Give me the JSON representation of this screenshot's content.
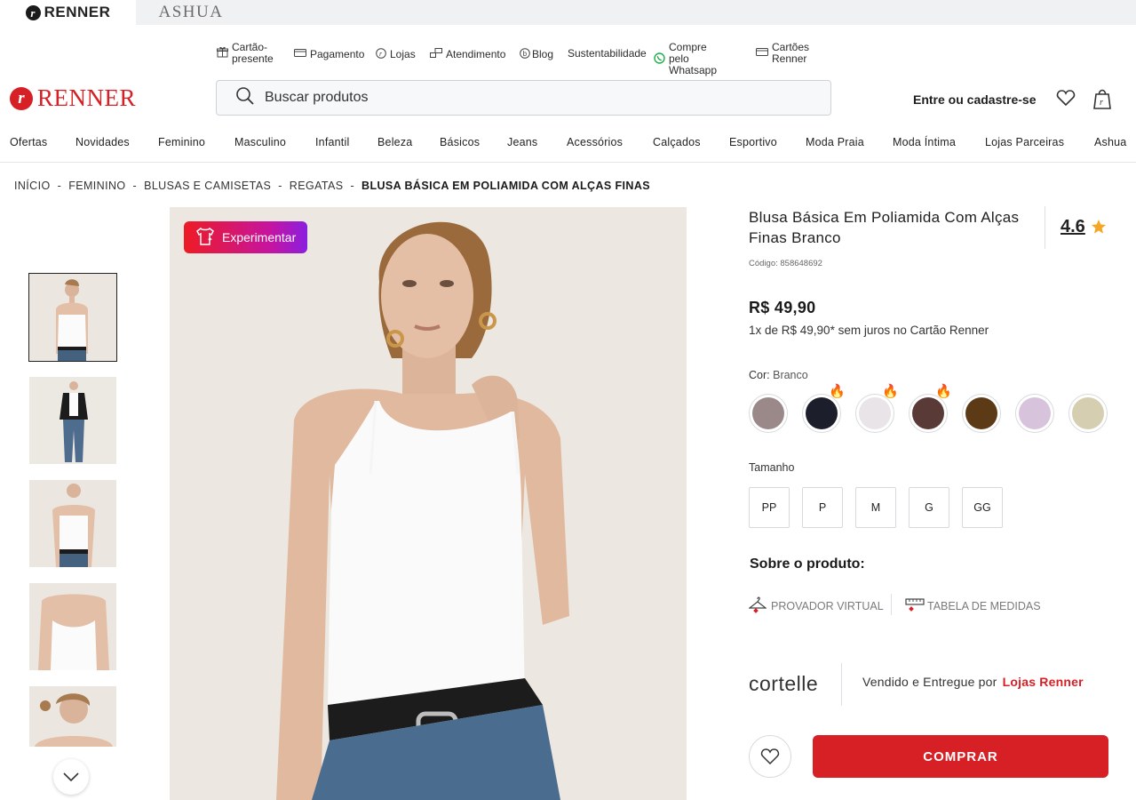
{
  "brands": {
    "renner": "RENNER",
    "ashua": "ASHUA"
  },
  "utility": [
    {
      "label": "Cartão-\npresente",
      "icon": "gift-icon"
    },
    {
      "label": "Pagamento",
      "icon": "payment-icon"
    },
    {
      "label": "Lojas",
      "icon": "store-icon"
    },
    {
      "label": "Atendimento",
      "icon": "support-icon"
    },
    {
      "label": "Blog",
      "icon": "blog-icon"
    },
    {
      "label": "Sustentabilidade",
      "icon": ""
    },
    {
      "label": "Compre pelo\nWhatsapp",
      "icon": "whatsapp-icon"
    },
    {
      "label": "Cartões\nRenner",
      "icon": "card-icon"
    }
  ],
  "header": {
    "logo": "RENNER",
    "search_placeholder": "Buscar produtos",
    "login": "Entre ou cadastre-se"
  },
  "nav": [
    "Ofertas",
    "Novidades",
    "Feminino",
    "Masculino",
    "Infantil",
    "Beleza",
    "Básicos",
    "Jeans",
    "Acessórios",
    "Calçados",
    "Esportivo",
    "Moda Praia",
    "Moda Íntima",
    "Lojas Parceiras",
    "Ashua"
  ],
  "breadcrumb": [
    "INÍCIO",
    "FEMININO",
    "BLUSAS E CAMISETAS",
    "REGATAS",
    "BLUSA BÁSICA EM POLIAMIDA COM ALÇAS FINAS"
  ],
  "try_on": "Experimentar",
  "product": {
    "title": "Blusa Básica Em Poliamida Com Alças Finas Branco",
    "rating": "4.6",
    "code": "Código: 858648692",
    "price": "R$ 49,90",
    "installments": "1x de R$ 49,90* sem juros no Cartão Renner",
    "color_label": "Cor:",
    "color_value": "Branco",
    "colors": [
      {
        "hex": "#9b8888",
        "hot": false
      },
      {
        "hex": "#1c1f2b",
        "hot": true
      },
      {
        "hex": "#e8e4e8",
        "hot": true
      },
      {
        "hex": "#5a3a36",
        "hot": true
      },
      {
        "hex": "#5c3a15",
        "hot": false
      },
      {
        "hex": "#d8c3dc",
        "hot": false
      },
      {
        "hex": "#d6ceb0",
        "hot": false
      }
    ],
    "size_label": "Tamanho",
    "sizes": [
      "PP",
      "P",
      "M",
      "G",
      "GG"
    ],
    "about": "Sobre o produto:",
    "virtual_fitting": "PROVADOR VIRTUAL",
    "size_chart": "TABELA DE MEDIDAS",
    "brand": "cortelle",
    "sold_by": "Vendido e Entregue por",
    "seller": "Lojas Renner",
    "buy": "COMPRAR"
  },
  "colors": {
    "brand_red": "#d71f26"
  }
}
